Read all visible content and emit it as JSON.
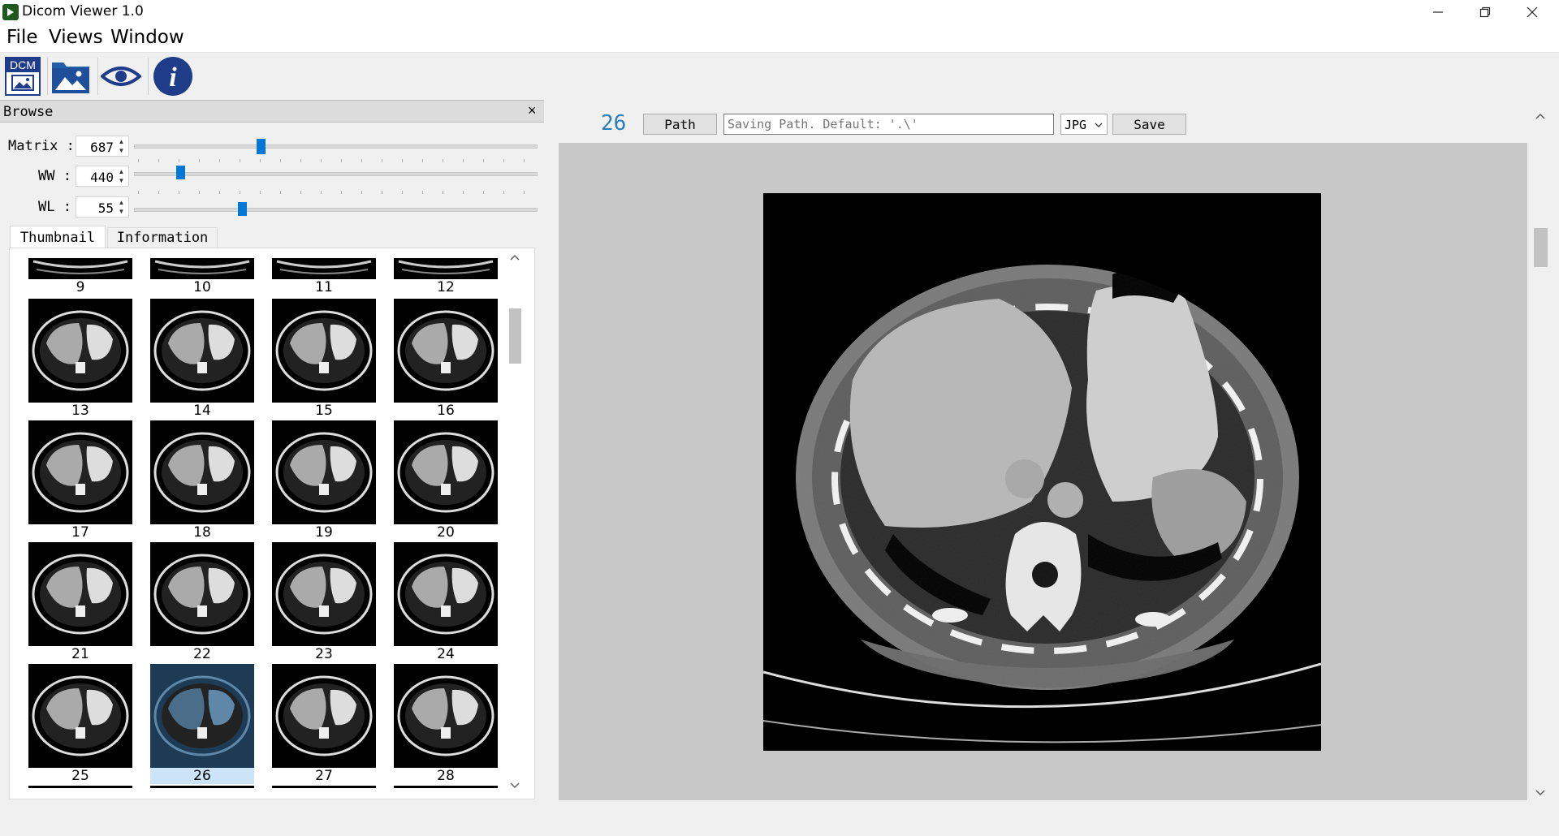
{
  "window": {
    "title": "Dicom Viewer 1.0",
    "controls": [
      "minimize",
      "restore",
      "close"
    ]
  },
  "menu": {
    "items": [
      "File",
      "Views",
      "Window"
    ]
  },
  "toolbar": {
    "open_dicom_label": "DCM",
    "tools": [
      "dicom-file-icon",
      "image-folder-icon",
      "eye-icon",
      "info-icon"
    ]
  },
  "dock": {
    "title": "Browse",
    "close_glyph": "×",
    "matrix": {
      "label": "Matrix :",
      "value": "687",
      "level": 0.32
    },
    "ww": {
      "label": "WW :",
      "value": "440",
      "level": 0.12
    },
    "wl": {
      "label": "WL :",
      "value": "55",
      "level": 0.27
    },
    "tabs": [
      "Thumbnail",
      "Information"
    ],
    "active_tab": "Thumbnail"
  },
  "thumbnails": {
    "rows": [
      [
        "9",
        "10",
        "11",
        "12"
      ],
      [
        "13",
        "14",
        "15",
        "16"
      ],
      [
        "17",
        "18",
        "19",
        "20"
      ],
      [
        "21",
        "22",
        "23",
        "24"
      ],
      [
        "25",
        "26",
        "27",
        "28"
      ]
    ],
    "selected": "26"
  },
  "save_bar": {
    "slice_number": "26",
    "path_button": "Path",
    "path_placeholder": "Saving Path. Default: '.\\'",
    "format": "JPG",
    "save_button": "Save"
  },
  "colors": {
    "accent": "#0078d7",
    "selection": "#cce4f7",
    "viewport_bg": "#c8c8c8"
  }
}
